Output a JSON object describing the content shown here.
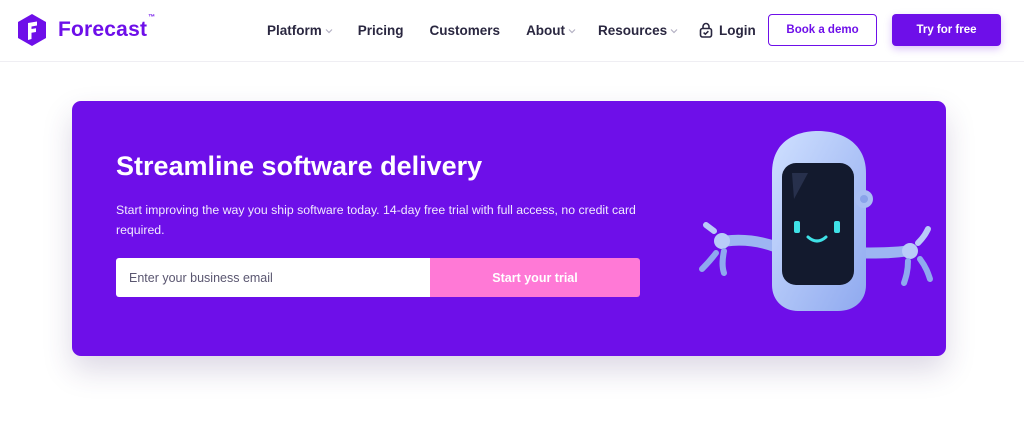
{
  "brand": {
    "name": "Forecast",
    "trademark": "™",
    "accent_color": "#6e0fe9",
    "pink_color": "#ff79d6"
  },
  "nav": {
    "items": [
      {
        "label": "Platform",
        "has_dropdown": true
      },
      {
        "label": "Pricing",
        "has_dropdown": false
      },
      {
        "label": "Customers",
        "has_dropdown": false
      },
      {
        "label": "About",
        "has_dropdown": true
      },
      {
        "label": "Resources",
        "has_dropdown": true
      }
    ],
    "login_label": "Login",
    "login_icon": "lock-check-icon",
    "book_demo_label": "Book a demo",
    "try_free_label": "Try for free"
  },
  "hero": {
    "title": "Streamline software delivery",
    "subtitle": "Start improving the way you ship software today. 14-day free trial with full access, no credit card required.",
    "email_placeholder": "Enter your business email",
    "email_value": "",
    "cta_label": "Start your trial",
    "illustration": "robot-mascot"
  }
}
